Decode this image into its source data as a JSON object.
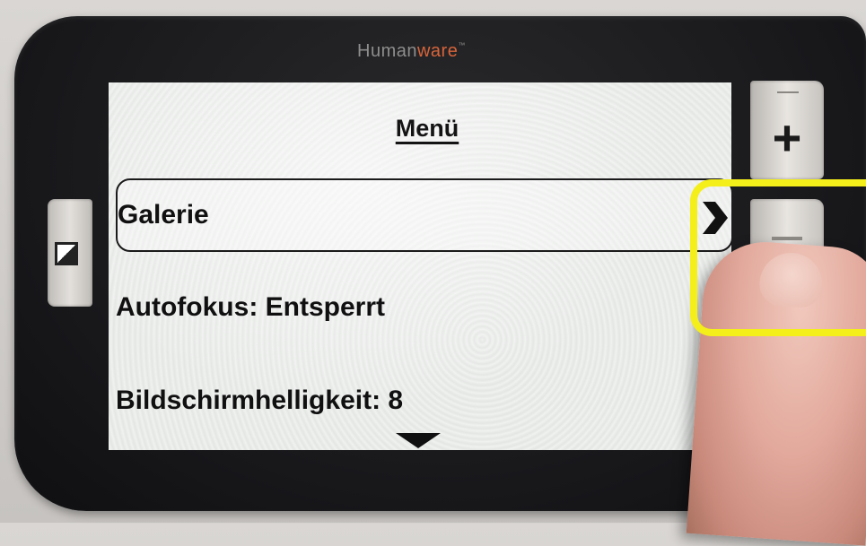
{
  "device": {
    "brand_human": "Human",
    "brand_ware": "ware",
    "brand_tm": "™"
  },
  "screen": {
    "title": "Menü",
    "items": [
      {
        "label": "Galerie",
        "selected": true,
        "icon": "chevron-right-icon"
      },
      {
        "label": "Autofokus: Entsperrt",
        "selected": false,
        "icon": "chevron-right-icon"
      },
      {
        "label": "Bildschirmhelligkeit: 8",
        "selected": false,
        "icon": "chevron-right-icon"
      }
    ],
    "more_indicator": "down-triangle-icon"
  },
  "buttons": {
    "zoom_in": "+",
    "zoom_out": "−",
    "contrast": "contrast-icon"
  },
  "colors": {
    "highlight": "#f4ee1a",
    "brand_accent": "#d8643a"
  }
}
